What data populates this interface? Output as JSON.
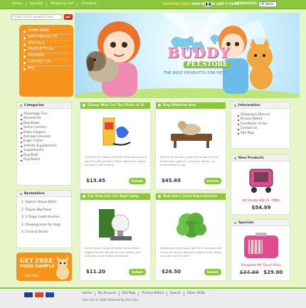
{
  "topnav": [
    "Home",
    "Log Out",
    "Shopping Cart",
    "Checkout"
  ],
  "cart_info": {
    "label": "SHOPPING CART:",
    "value": "NOW IN YOUR CART 0 ITEMS"
  },
  "currency": {
    "label": "CURRENCIES:",
    "selected": "US Dollar"
  },
  "search": {
    "placeholder": "Enter search keywords here",
    "button": "go!"
  },
  "main_menu": [
    "HOME PAGE",
    "NEW PRODUCTS",
    "SPECIALS",
    "PRODUCTS ALL",
    "REVIEWS",
    "CONTACT US",
    "FAQ"
  ],
  "banner": {
    "logo_main": "BUDDY",
    "logo_sub": "PET.STORE",
    "tagline": "THE BEST PRODUCTS FOR PETS"
  },
  "categories": {
    "title": "Categories",
    "items": [
      "Advantage Flea",
      "Advanta Kit",
      "Dog Bowls",
      "Airline Carriers",
      "Radio Clippers",
      "Anti bark Devices",
      "Jingle Collars",
      "Arthritic Supplements",
      "Supplements",
      "Dog Beds",
      "Dog Beach"
    ]
  },
  "bestsellers": {
    "title": "Bestsellers",
    "items": [
      "1. Vaporic House Sitter",
      "2. Tripple dog Tower",
      "3. 3 Finger tooth brushes",
      "4. Chewing bone for dogs",
      "5. Coconut beans"
    ]
  },
  "promo": {
    "line1": "GET FREE",
    "line2": "FOOD SAMPLE",
    "line3": "» Click Here"
  },
  "products": [
    {
      "title": "Chewy Mini Cat Toy (Pack of 3)",
      "desc": "Consect etur adipi scing elit. Duis sed lacus at sem feugiat porttitor. Fusce dignis sim neque eu lorem, elit tempus.",
      "price": "$13.45",
      "button": "Details"
    },
    {
      "title": "Dog Platform Bed",
      "desc": "Nullam at est sed augue commodo ultrices. Vestibulum eget mi, sed justo dictum, ac. Suspendisse in elit.",
      "price": "$45.69",
      "button": "Details"
    },
    {
      "title": "Cat Tosa Sun Clo Spot Lamp 150W",
      "desc": "Lorem ipsum dolor sit amet, consectetur adipiscing elit. Mauris at nunc lorem, sed volutpat tortor mattis consequat.",
      "price": "$11.20",
      "button": "Details"
    },
    {
      "title": "Red Sea's Coral Reproduction",
      "desc": "Vestibulum ante ipsum primis in faucibus orci luctus et ultrices posuere cubilia curae. Nulla rhoncus nunc eu velit.",
      "price": "$26.50",
      "button": "Details"
    }
  ],
  "information": {
    "title": "Information",
    "items": [
      "Shipping & Returns",
      "Privacy Notice",
      "Conditions of Use",
      "Contact Us",
      "Site Map"
    ]
  },
  "new_products": {
    "title": "New Products",
    "name": "Pet Stroller Ball (S - PINK)",
    "price": "$54.99"
  },
  "specials": {
    "title": "Specials",
    "name": "Pampered Pet Travel (Pink)",
    "old_price": "$34.99",
    "price": "$29.00"
  },
  "footer": {
    "links": [
      "Home",
      "My Account",
      "Site Map",
      "Privacy Notice",
      "Search",
      "Adver DVDs"
    ],
    "copyright": "Zen Cart © 2010 Powered by Zen Cart"
  },
  "colors": {
    "green": "#8cc63f",
    "orange": "#f7941d",
    "red": "#e02b2b",
    "pink": "#f39cc2"
  }
}
